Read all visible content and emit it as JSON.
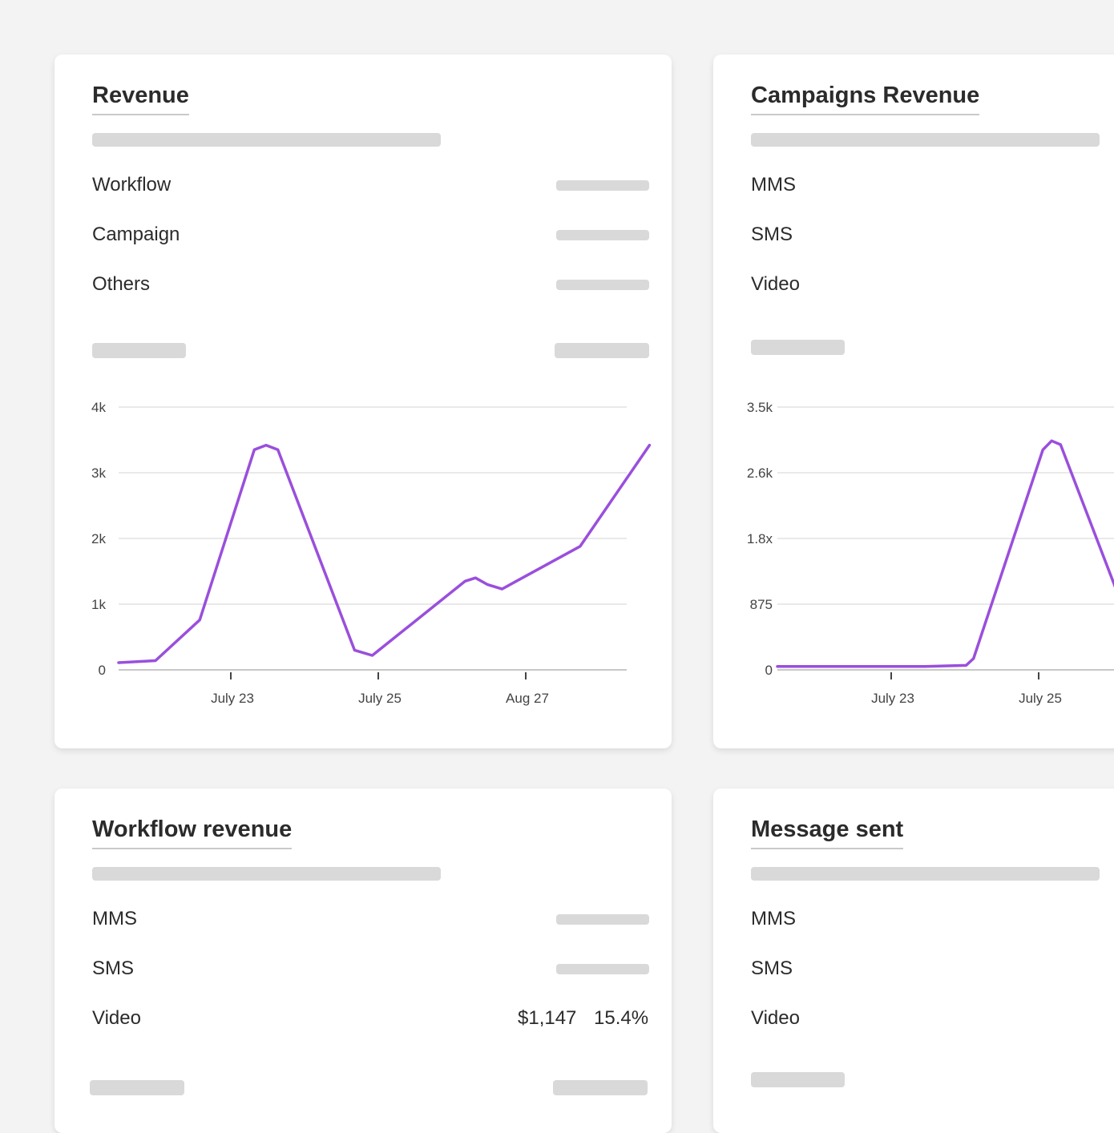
{
  "colors": {
    "line": "#9a4fdc",
    "grid": "#dcdcdc",
    "skeleton": "#d9d9d9",
    "background": "#f3f3f3"
  },
  "cards": {
    "revenue": {
      "title": "Revenue",
      "rows": [
        {
          "label": "Workflow"
        },
        {
          "label": "Campaign"
        },
        {
          "label": "Others"
        }
      ]
    },
    "campaigns": {
      "title": "Campaigns Revenue",
      "rows": [
        {
          "label": "MMS"
        },
        {
          "label": "SMS"
        },
        {
          "label": "Video"
        }
      ]
    },
    "workflow": {
      "title": "Workflow revenue",
      "rows": [
        {
          "label": "MMS"
        },
        {
          "label": "SMS"
        },
        {
          "label": "Video",
          "amount": "$1,147",
          "percent": "15.4%"
        }
      ]
    },
    "messages": {
      "title": "Message sent",
      "rows": [
        {
          "label": "MMS"
        },
        {
          "label": "SMS"
        },
        {
          "label": "Video"
        }
      ]
    }
  },
  "chart_data": [
    {
      "type": "line",
      "y_ticks": [
        "0",
        "1k",
        "2k",
        "3k",
        "4k"
      ],
      "ylim": [
        0,
        4000
      ],
      "x_ticks": [
        "July 23",
        "July 25",
        "Aug 27"
      ],
      "grid": true,
      "series": [
        {
          "color": "#9a4fdc",
          "points": [
            {
              "x": 0.0,
              "y": 110
            },
            {
              "x": 0.25,
              "y": 140
            },
            {
              "x": 0.55,
              "y": 760
            },
            {
              "x": 0.92,
              "y": 3350
            },
            {
              "x": 1.0,
              "y": 3420
            },
            {
              "x": 1.08,
              "y": 3350
            },
            {
              "x": 1.6,
              "y": 300
            },
            {
              "x": 1.72,
              "y": 220
            },
            {
              "x": 2.35,
              "y": 1350
            },
            {
              "x": 2.42,
              "y": 1400
            },
            {
              "x": 2.5,
              "y": 1300
            },
            {
              "x": 2.6,
              "y": 1230
            },
            {
              "x": 3.13,
              "y": 1880
            },
            {
              "x": 3.6,
              "y": 3420
            }
          ]
        }
      ]
    },
    {
      "type": "line",
      "y_ticks": [
        "0",
        "875",
        "1.8x",
        "2.6k",
        "3.5k"
      ],
      "ylim": [
        0,
        3500
      ],
      "x_ticks": [
        "July 23",
        "July 25"
      ],
      "grid": true,
      "series": [
        {
          "color": "#9a4fdc",
          "points": [
            {
              "x": 0.0,
              "y": 45
            },
            {
              "x": 0.55,
              "y": 45
            },
            {
              "x": 1.0,
              "y": 45
            },
            {
              "x": 1.28,
              "y": 60
            },
            {
              "x": 1.33,
              "y": 150
            },
            {
              "x": 1.8,
              "y": 2930
            },
            {
              "x": 1.86,
              "y": 3050
            },
            {
              "x": 1.92,
              "y": 3000
            },
            {
              "x": 2.35,
              "y": 800
            },
            {
              "x": 2.55,
              "y": 640
            }
          ]
        }
      ]
    }
  ]
}
